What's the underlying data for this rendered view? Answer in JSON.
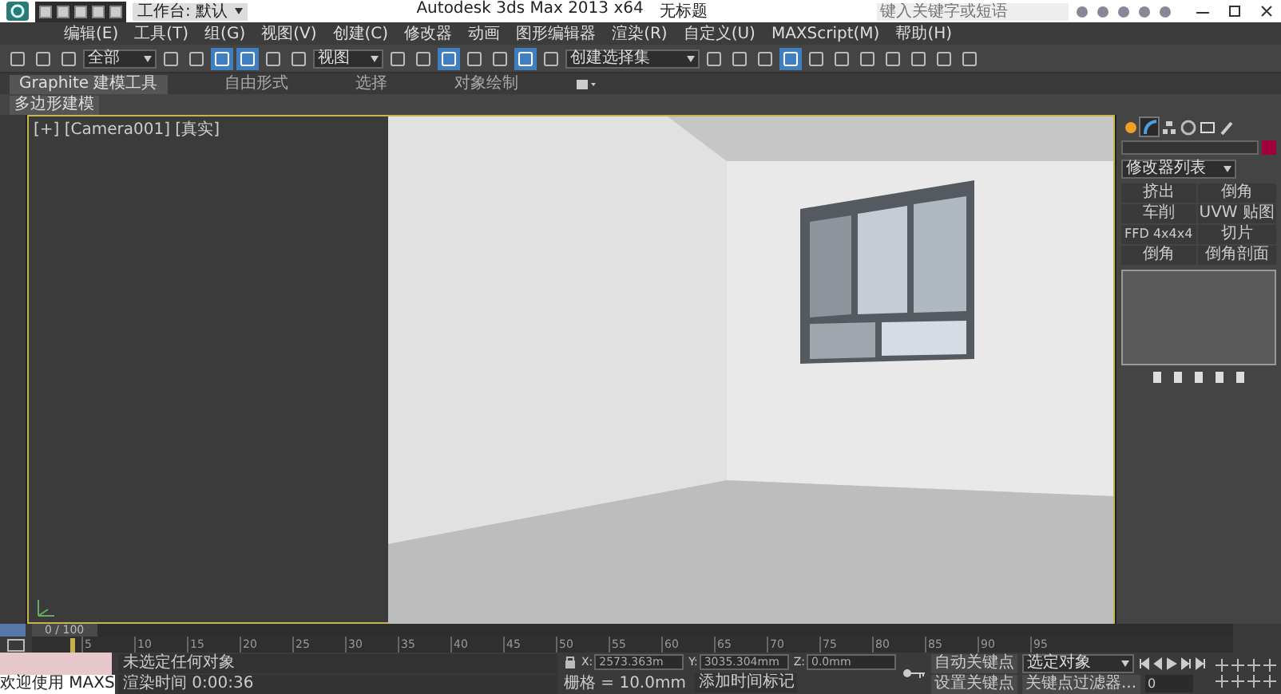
{
  "title_bar": {
    "workspace": "工作台: 默认",
    "app_title": "Autodesk 3ds Max  2013 x64",
    "file_name": "无标题",
    "search": {
      "placeholder": "键入关键字或短语"
    }
  },
  "menu": [
    "编辑(E)",
    "工具(T)",
    "组(G)",
    "视图(V)",
    "创建(C)",
    "修改器",
    "动画",
    "图形编辑器",
    "渲染(R)",
    "自定义(U)",
    "MAXScript(M)",
    "帮助(H)"
  ],
  "toolbar": {
    "selection_filter": "全部",
    "reference_coord": "视图",
    "named_selection": "创建选择集"
  },
  "ribbon": {
    "tabs": [
      {
        "label": "Graphite 建模工具",
        "selected": true
      },
      {
        "label": "自由形式",
        "selected": false
      },
      {
        "label": "选择",
        "selected": false
      },
      {
        "label": "对象绘制",
        "selected": false
      }
    ],
    "panel": "多边形建模"
  },
  "viewport": {
    "label": "[+] [Camera001] [真实]",
    "active": true
  },
  "command_panel": {
    "tabs": [
      {
        "kind": "create",
        "selected": false
      },
      {
        "kind": "modify",
        "selected": true
      },
      {
        "kind": "hierarchy",
        "selected": false
      },
      {
        "kind": "motion",
        "selected": false
      },
      {
        "kind": "display",
        "selected": false
      },
      {
        "kind": "utilities",
        "selected": false
      }
    ],
    "modifier_list": "修改器列表",
    "modifiers": [
      "挤出",
      "倒角",
      "车削",
      "UVW 贴图",
      "FFD 4x4x4",
      "切片",
      "倒角",
      "倒角剖面"
    ]
  },
  "timeline": {
    "frame_counter": "0 / 100",
    "level": 0,
    "ticks": [
      "5",
      "10",
      "15",
      "20",
      "25",
      "30",
      "35",
      "40",
      "45",
      "50",
      "55",
      "60",
      "65",
      "70",
      "75",
      "80",
      "85",
      "90",
      "95"
    ]
  },
  "status": {
    "script_listener": "欢迎使用 MAXS",
    "prompt": "未选定任何对象",
    "render_time": "渲染时间 0:00:36",
    "x_label": "X:",
    "x": "2573.363m",
    "y_label": "Y:",
    "y": "3035.304mm",
    "z_label": "Z:",
    "z": "0.0mm",
    "grid": "栅格 = 10.0mm",
    "add_time_tag": "添加时间标记",
    "auto_key": "自动关键点",
    "key_mode": "选定对象",
    "set_key": "设置关键点",
    "key_filters": "关键点过滤器...",
    "current_frame": "0"
  }
}
